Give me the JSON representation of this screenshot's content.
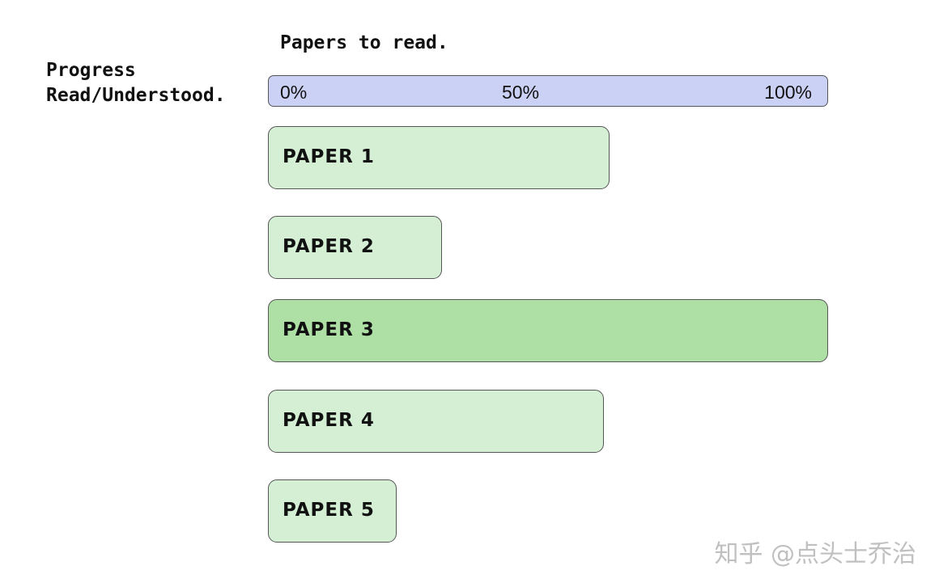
{
  "chart_data": {
    "type": "bar",
    "orientation": "horizontal",
    "title": "Papers to read.",
    "ylabel": "Progress Read/Understood.",
    "ylabel_lines": [
      "Progress",
      "Read/Understood."
    ],
    "xlim": [
      0,
      100
    ],
    "xticks": [
      "0%",
      "50%",
      "100%"
    ],
    "categories": [
      "PAPER 1",
      "PAPER 2",
      "PAPER 3",
      "PAPER 4",
      "PAPER 5"
    ],
    "values": [
      61,
      31,
      100,
      60,
      23
    ],
    "colors": {
      "bar": "#d4efd4",
      "complete_bar": "#aee0a5",
      "axis_bar": "#cbd0f5",
      "border": "#555555"
    }
  },
  "watermark": "知乎 @点头士乔治"
}
